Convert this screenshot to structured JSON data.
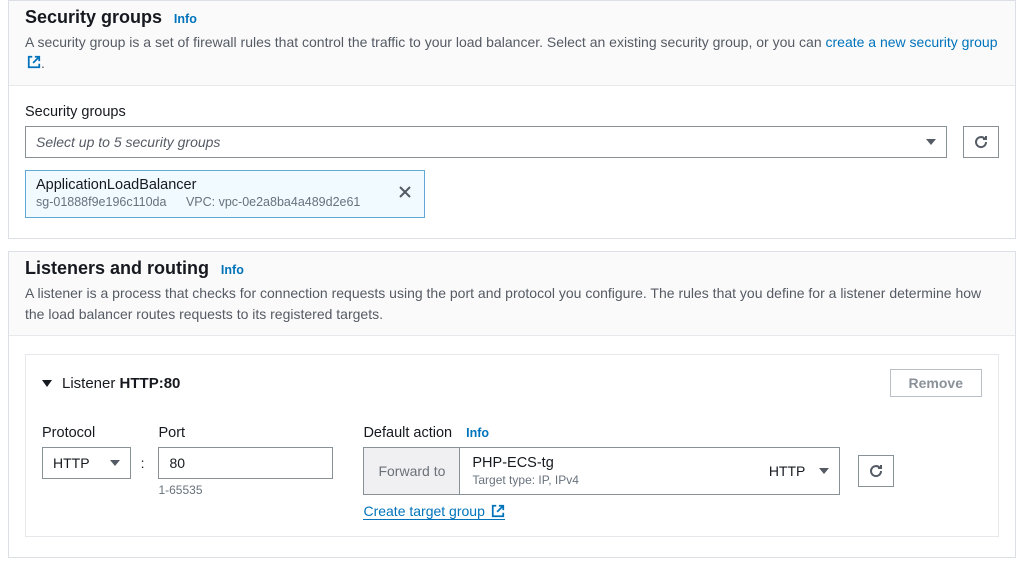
{
  "security": {
    "title": "Security groups",
    "info": "Info",
    "desc_pre": "A security group is a set of firewall rules that control the traffic to your load balancer. Select an existing security group, or you can ",
    "desc_link": "create a new security group",
    "desc_post": ".",
    "field_label": "Security groups",
    "select_placeholder": "Select up to 5 security groups",
    "selected": {
      "name": "ApplicationLoadBalancer",
      "sg_id": "sg-01888f9e196c110da",
      "vpc": "VPC: vpc-0e2a8ba4a489d2e61"
    }
  },
  "listeners": {
    "title": "Listeners and routing",
    "info": "Info",
    "desc": "A listener is a process that checks for connection requests using the port and protocol you configure. The rules that you define for a listener determine how the load balancer routes requests to its registered targets.",
    "listener": {
      "header_prefix": "Listener",
      "header_value": "HTTP:80",
      "remove": "Remove",
      "protocol_label": "Protocol",
      "protocol_value": "HTTP",
      "port_label": "Port",
      "port_value": "80",
      "port_hint": "1-65535",
      "da_label": "Default action",
      "da_info": "Info",
      "forward_to": "Forward to",
      "target_name": "PHP-ECS-tg",
      "target_sub": "Target type: IP, IPv4",
      "target_proto": "HTTP",
      "create_target": "Create target group"
    }
  }
}
